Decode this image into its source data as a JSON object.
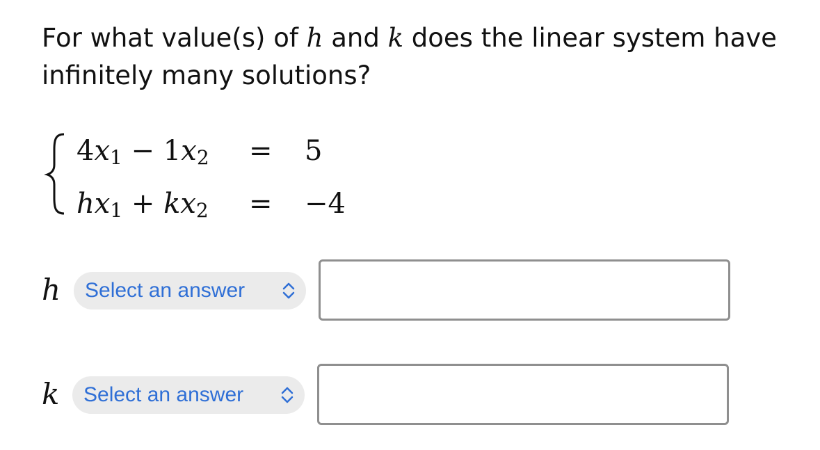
{
  "question": {
    "part1": "For what value(s) of ",
    "var_h": "h",
    "part2": " and ",
    "var_k": "k",
    "part3": " does the linear system have infinitely many solutions?"
  },
  "system": {
    "rows": [
      {
        "lhs_coef1": "4",
        "lhs_var1": "x",
        "lhs_sub1": "1",
        "op": " − ",
        "lhs_coef2": "1",
        "lhs_var2": "x",
        "lhs_sub2": "2",
        "equals": "=",
        "rhs": "5"
      },
      {
        "lhs_coef1": "h",
        "lhs_var1": "x",
        "lhs_sub1": "1",
        "op": " + ",
        "lhs_coef2": "k",
        "lhs_var2": "x",
        "lhs_sub2": "2",
        "equals": "=",
        "rhs": "−4"
      }
    ]
  },
  "answers": {
    "h": {
      "label": "h",
      "select_text": "Select an answer",
      "input_value": ""
    },
    "k": {
      "label": "k",
      "select_text": "Select an answer",
      "input_value": ""
    }
  },
  "colors": {
    "link_blue": "#2f6fd6",
    "pill_bg": "#ebebeb",
    "input_border": "#8f8f8f"
  },
  "icons": {
    "select_chevron": "up-down-chevron-icon"
  }
}
